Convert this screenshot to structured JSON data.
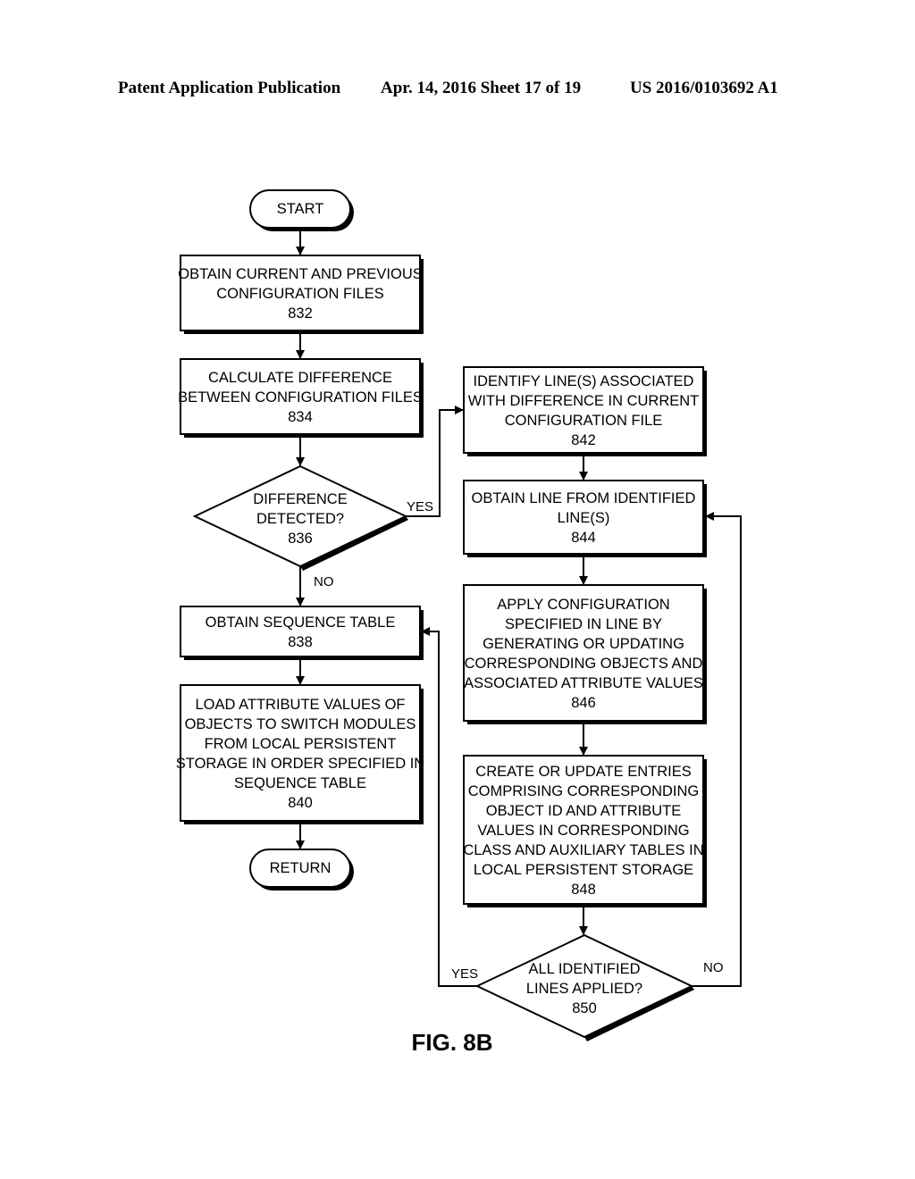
{
  "header": {
    "publication": "Patent Application Publication",
    "date_sheet": "Apr. 14, 2016  Sheet 17 of 19",
    "number": "US 2016/0103692 A1"
  },
  "figure_label": "FIG. 8B",
  "nodes": {
    "start": {
      "type": "terminal",
      "lines": [
        "START"
      ]
    },
    "n832": {
      "type": "process",
      "lines": [
        "OBTAIN CURRENT AND PREVIOUS",
        "CONFIGURATION FILES",
        "832"
      ]
    },
    "n834": {
      "type": "process",
      "lines": [
        "CALCULATE DIFFERENCE",
        "BETWEEN CONFIGURATION FILES",
        "834"
      ]
    },
    "n836": {
      "type": "decision",
      "lines": [
        "DIFFERENCE",
        "DETECTED?",
        "836"
      ]
    },
    "n838": {
      "type": "process",
      "lines": [
        "OBTAIN SEQUENCE TABLE",
        "838"
      ]
    },
    "n840": {
      "type": "process",
      "lines": [
        "LOAD ATTRIBUTE VALUES OF",
        "OBJECTS TO SWITCH MODULES",
        "FROM LOCAL PERSISTENT",
        "STORAGE IN ORDER SPECIFIED IN",
        "SEQUENCE TABLE",
        "840"
      ]
    },
    "return": {
      "type": "terminal",
      "lines": [
        "RETURN"
      ]
    },
    "n842": {
      "type": "process",
      "lines": [
        "IDENTIFY LINE(S) ASSOCIATED",
        "WITH DIFFERENCE IN CURRENT",
        "CONFIGURATION FILE",
        "842"
      ]
    },
    "n844": {
      "type": "process",
      "lines": [
        "OBTAIN LINE FROM IDENTIFIED",
        "LINE(S)",
        "844"
      ]
    },
    "n846": {
      "type": "process",
      "lines": [
        "APPLY CONFIGURATION",
        "SPECIFIED IN LINE BY",
        "GENERATING OR UPDATING",
        "CORRESPONDING OBJECTS AND",
        "ASSOCIATED ATTRIBUTE VALUES",
        "846"
      ]
    },
    "n848": {
      "type": "process",
      "lines": [
        "CREATE OR UPDATE ENTRIES",
        "COMPRISING CORRESPONDING",
        "OBJECT ID AND ATTRIBUTE",
        "VALUES IN CORRESPONDING",
        "CLASS AND AUXILIARY TABLES IN",
        "LOCAL PERSISTENT STORAGE",
        "848"
      ]
    },
    "n850": {
      "type": "decision",
      "lines": [
        "ALL IDENTIFIED",
        "LINES APPLIED?",
        "850"
      ]
    }
  },
  "edges": [
    {
      "from": "start",
      "to": "n832",
      "label": ""
    },
    {
      "from": "n832",
      "to": "n834",
      "label": ""
    },
    {
      "from": "n834",
      "to": "n836",
      "label": ""
    },
    {
      "from": "n836",
      "to": "n842",
      "label": "YES"
    },
    {
      "from": "n836",
      "to": "n838",
      "label": "NO"
    },
    {
      "from": "n838",
      "to": "n840",
      "label": ""
    },
    {
      "from": "n840",
      "to": "return",
      "label": ""
    },
    {
      "from": "n842",
      "to": "n844",
      "label": ""
    },
    {
      "from": "n844",
      "to": "n846",
      "label": ""
    },
    {
      "from": "n846",
      "to": "n848",
      "label": ""
    },
    {
      "from": "n848",
      "to": "n850",
      "label": ""
    },
    {
      "from": "n850",
      "to": "n838",
      "label": "YES"
    },
    {
      "from": "n850",
      "to": "n844",
      "label": "NO"
    }
  ]
}
